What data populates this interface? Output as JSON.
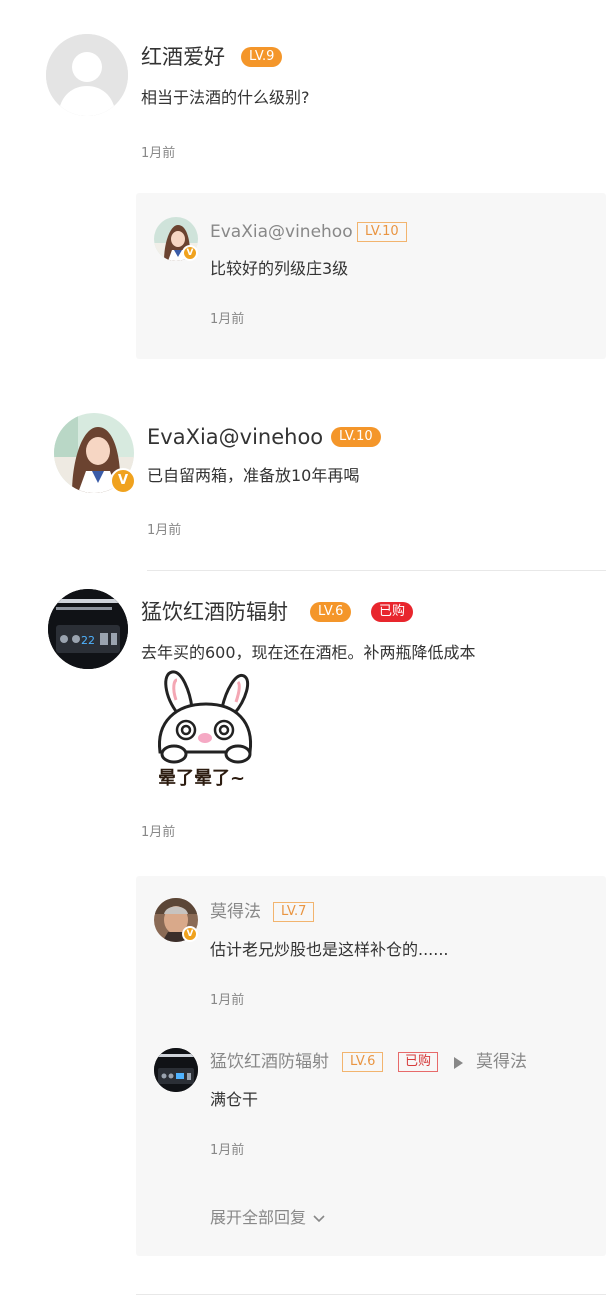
{
  "comments": [
    {
      "user": "红酒爱好",
      "level": "LV.9",
      "avatar_icon": "default-avatar-icon",
      "text": "相当于法酒的什么级别?",
      "time": "1月前",
      "replies": [
        {
          "user": "EvaXia@vinehoo",
          "level": "LV.10",
          "verified": true,
          "avatar_icon": "photo-avatar-icon",
          "text": "比较好的列级庄3级",
          "time": "1月前"
        }
      ]
    },
    {
      "user": "EvaXia@vinehoo",
      "level": "LV.10",
      "verified": true,
      "verified_mark": "V",
      "avatar_icon": "photo-avatar-icon",
      "text": "已自留两箱，准备放10年再喝",
      "time": "1月前"
    },
    {
      "user": "猛饮红酒防辐射",
      "level": "LV.6",
      "bought_tag": "已购",
      "avatar_icon": "wine-cabinet-panel-avatar-icon",
      "avatar_text": "22",
      "text": "去年买的600，现在还在酒柜。补两瓶降低成本",
      "sticker_icon": "dizzy-bunny-sticker-icon",
      "sticker_caption": "晕了晕了~",
      "time": "1月前",
      "replies": [
        {
          "user": "莫得法",
          "level": "LV.7",
          "verified": true,
          "avatar_icon": "man-photo-avatar-icon",
          "text": "估计老兄炒股也是这样补仓的......",
          "time": "1月前"
        },
        {
          "user": "猛饮红酒防辐射",
          "level": "LV.6",
          "bought_tag": "已购",
          "reply_to": "莫得法",
          "avatar_icon": "wine-cabinet-panel-avatar-icon",
          "text": "满仓干",
          "time": "1月前"
        }
      ],
      "expand_label": "展开全部回复"
    }
  ],
  "colors": {
    "level_orange": "#f4962a",
    "bought_red": "#e8262d",
    "reply_bg": "#f7f7f7",
    "muted_text": "#888888"
  }
}
